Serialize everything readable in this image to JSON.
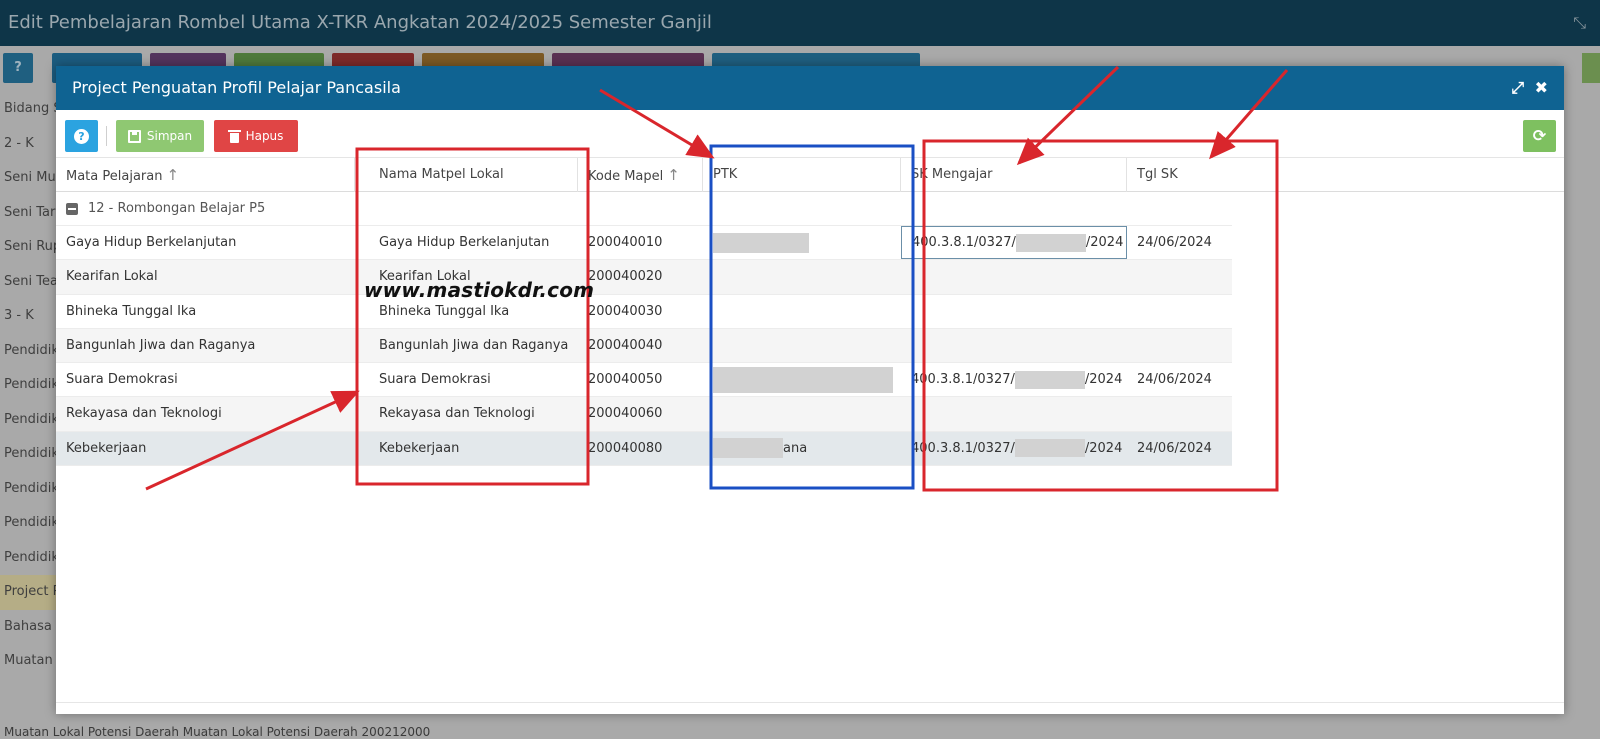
{
  "background": {
    "title": "Edit Pembelajaran Rombel Utama X-TKR Angkatan 2024/2025 Semester Ganjil",
    "rows": [
      "Bidang S",
      "2 - K",
      "Seni Mus",
      "Seni Tari",
      "Seni Rup",
      "Seni Tea",
      "3 - K",
      "Pendidik",
      "Pendidik",
      "Pendidik",
      "Pendidik",
      "Pendidik",
      "Pendidik",
      "Pendidik",
      "Project P",
      "Bahasa I",
      "Muatan"
    ],
    "bottom_text": "Muatan Lokal Potensi Daerah          Muatan Lokal Potensi Daerah          200212000"
  },
  "modal": {
    "title": "Project Penguatan Profil Pelajar Pancasila",
    "toolbar": {
      "help_label": "?",
      "save_label": "Simpan",
      "delete_label": "Hapus"
    },
    "columns": {
      "mapel": "Mata Pelajaran",
      "lokal": "Nama Matpel Lokal",
      "kode": "Kode Mapel",
      "ptk": "PTK",
      "sk": "SK Mengajar",
      "tgl": "Tgl SK"
    },
    "group_label": "12 - Rombongan Belajar P5",
    "rows": [
      {
        "mapel": "Gaya Hidup Berkelanjutan",
        "lokal": "Gaya Hidup Berkelanjutan",
        "kode": "200040010",
        "ptk_suffix": "",
        "sk_prefix": "400.3.8.1/0327/",
        "sk_suffix": "/2024",
        "tgl": "24/06/2024"
      },
      {
        "mapel": "Kearifan Lokal",
        "lokal": "Kearifan Lokal",
        "kode": "200040020",
        "ptk_suffix": "",
        "sk_prefix": "",
        "sk_suffix": "",
        "tgl": ""
      },
      {
        "mapel": "Bhineka Tunggal Ika",
        "lokal": "Bhineka Tunggal Ika",
        "kode": "200040030",
        "ptk_suffix": "",
        "sk_prefix": "",
        "sk_suffix": "",
        "tgl": ""
      },
      {
        "mapel": "Bangunlah Jiwa dan Raganya",
        "lokal": "Bangunlah Jiwa dan Raganya",
        "kode": "200040040",
        "ptk_suffix": "",
        "sk_prefix": "",
        "sk_suffix": "",
        "tgl": ""
      },
      {
        "mapel": "Suara Demokrasi",
        "lokal": "Suara Demokrasi",
        "kode": "200040050",
        "ptk_suffix": "",
        "sk_prefix": "400.3.8.1/0327/",
        "sk_suffix": "/2024",
        "tgl": "24/06/2024"
      },
      {
        "mapel": "Rekayasa dan Teknologi",
        "lokal": "Rekayasa dan Teknologi",
        "kode": "200040060",
        "ptk_suffix": "",
        "sk_prefix": "",
        "sk_suffix": "",
        "tgl": ""
      },
      {
        "mapel": "Kebekerjaan",
        "lokal": "Kebekerjaan",
        "kode": "200040080",
        "ptk_suffix": "ana",
        "sk_prefix": "400.3.8.1/0327/",
        "sk_suffix": "/2024",
        "tgl": "24/06/2024"
      }
    ]
  },
  "watermark": "www.mastiokdr.com",
  "annotation_colors": {
    "red": "#d9262c",
    "blue": "#1a4fc4"
  }
}
